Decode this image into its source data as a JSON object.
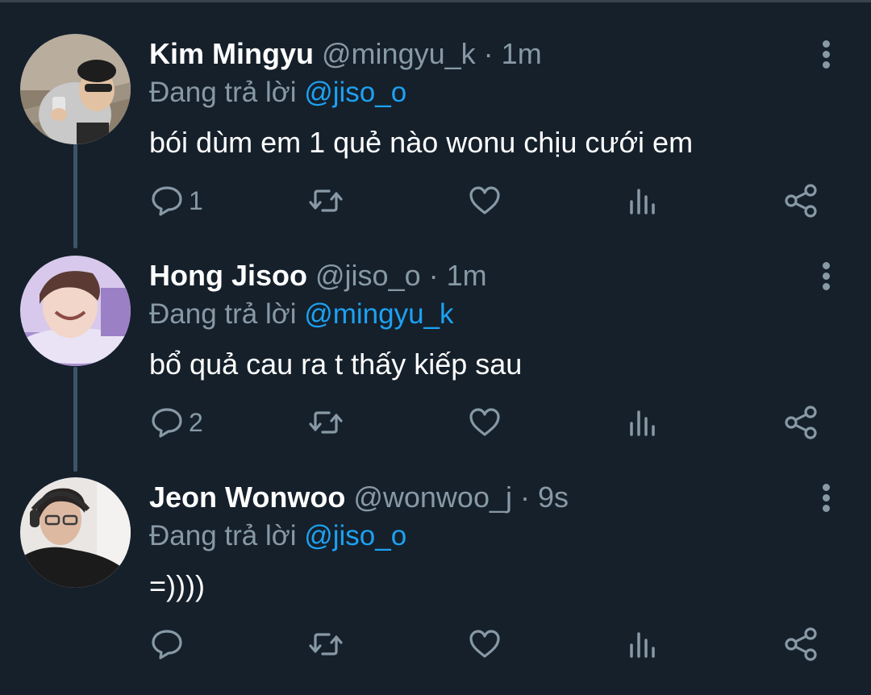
{
  "colors": {
    "background": "#15202b",
    "muted": "#8899a6",
    "mention": "#1da1f2",
    "thread_line": "#3d5466"
  },
  "tweets": [
    {
      "name": "Kim Mingyu",
      "handle": "@mingyu_k",
      "dot": "·",
      "time": "1m",
      "replying_prefix": "Đang trả lời",
      "replying_to": "@jiso_o",
      "text": "bói dùm em 1 quẻ nào wonu chịu cưới em",
      "reply_count": "1"
    },
    {
      "name": "Hong Jisoo",
      "handle": "@jiso_o",
      "dot": "·",
      "time": "1m",
      "replying_prefix": "Đang trả lời",
      "replying_to": "@mingyu_k",
      "text": "bổ quả cau ra t thấy kiếp sau",
      "reply_count": "2"
    },
    {
      "name": "Jeon Wonwoo",
      "handle": "@wonwoo_j",
      "dot": "·",
      "time": "9s",
      "replying_prefix": "Đang trả lời",
      "replying_to": "@jiso_o",
      "text": "=))))",
      "reply_count": ""
    }
  ],
  "icons": [
    "reply-icon",
    "retweet-icon",
    "like-icon",
    "analytics-icon",
    "share-icon",
    "more-options-icon"
  ]
}
